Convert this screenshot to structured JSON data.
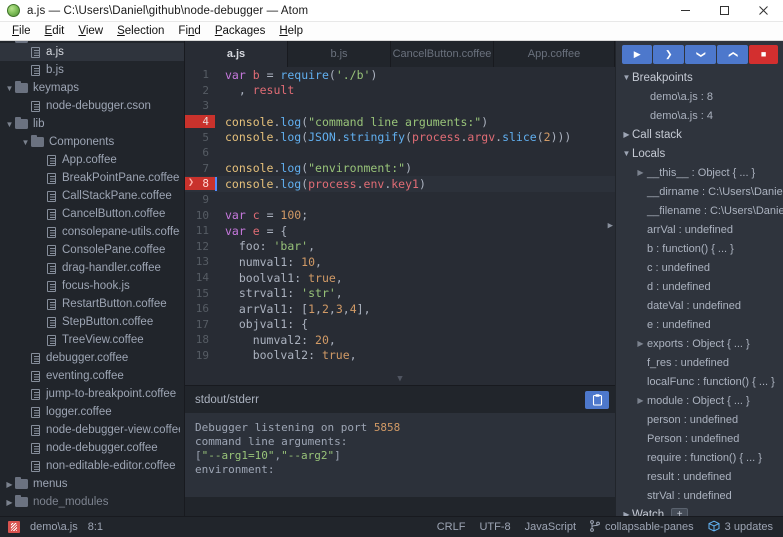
{
  "window": {
    "title": "a.js — C:\\Users\\Daniel\\github\\node-debugger — Atom",
    "app_icon": "atom-logo-icon",
    "minimize_label": "minimize-icon",
    "maximize_label": "maximize-icon",
    "close_label": "close-icon"
  },
  "menubar": {
    "items": [
      {
        "label": "File",
        "accel": "F"
      },
      {
        "label": "Edit",
        "accel": "E"
      },
      {
        "label": "View",
        "accel": "V"
      },
      {
        "label": "Selection",
        "accel": "S"
      },
      {
        "label": "Find",
        "accel": "n"
      },
      {
        "label": "Packages",
        "accel": "P"
      },
      {
        "label": "Help",
        "accel": "H"
      }
    ]
  },
  "tree": {
    "items": [
      {
        "label": "demo",
        "type": "folder",
        "depth": 1,
        "expanded": true,
        "selected": false,
        "clipped": true
      },
      {
        "label": "a.js",
        "type": "file",
        "depth": 2,
        "selected": true
      },
      {
        "label": "b.js",
        "type": "file",
        "depth": 2,
        "selected": false
      },
      {
        "label": "keymaps",
        "type": "folder",
        "depth": 1,
        "expanded": true,
        "selected": false
      },
      {
        "label": "node-debugger.cson",
        "type": "file",
        "depth": 2,
        "selected": false
      },
      {
        "label": "lib",
        "type": "folder",
        "depth": 1,
        "expanded": true,
        "selected": false
      },
      {
        "label": "Components",
        "type": "folder",
        "depth": 2,
        "expanded": true,
        "selected": false
      },
      {
        "label": "App.coffee",
        "type": "file",
        "depth": 3,
        "selected": false
      },
      {
        "label": "BreakPointPane.coffee",
        "type": "file",
        "depth": 3,
        "selected": false
      },
      {
        "label": "CallStackPane.coffee",
        "type": "file",
        "depth": 3,
        "selected": false
      },
      {
        "label": "CancelButton.coffee",
        "type": "file",
        "depth": 3,
        "selected": false
      },
      {
        "label": "consolepane-utils.coffee",
        "type": "file",
        "depth": 3,
        "selected": false
      },
      {
        "label": "ConsolePane.coffee",
        "type": "file",
        "depth": 3,
        "selected": false
      },
      {
        "label": "drag-handler.coffee",
        "type": "file",
        "depth": 3,
        "selected": false
      },
      {
        "label": "focus-hook.js",
        "type": "file",
        "depth": 3,
        "selected": false
      },
      {
        "label": "RestartButton.coffee",
        "type": "file",
        "depth": 3,
        "selected": false
      },
      {
        "label": "StepButton.coffee",
        "type": "file",
        "depth": 3,
        "selected": false
      },
      {
        "label": "TreeView.coffee",
        "type": "file",
        "depth": 3,
        "selected": false
      },
      {
        "label": "debugger.coffee",
        "type": "file",
        "depth": 2,
        "selected": false
      },
      {
        "label": "eventing.coffee",
        "type": "file",
        "depth": 2,
        "selected": false
      },
      {
        "label": "jump-to-breakpoint.coffee",
        "type": "file",
        "depth": 2,
        "selected": false
      },
      {
        "label": "logger.coffee",
        "type": "file",
        "depth": 2,
        "selected": false
      },
      {
        "label": "node-debugger-view.coffee",
        "type": "file",
        "depth": 2,
        "selected": false
      },
      {
        "label": "node-debugger.coffee",
        "type": "file",
        "depth": 2,
        "selected": false
      },
      {
        "label": "non-editable-editor.coffee",
        "type": "file",
        "depth": 2,
        "selected": false
      },
      {
        "label": "menus",
        "type": "folder",
        "depth": 1,
        "expanded": false,
        "selected": false
      },
      {
        "label": "node_modules",
        "type": "folder",
        "depth": 1,
        "expanded": false,
        "selected": false,
        "dim": true
      }
    ]
  },
  "tabs": [
    {
      "label": "a.js",
      "active": true
    },
    {
      "label": "b.js",
      "active": false
    },
    {
      "label": "CancelButton.coffee",
      "active": false
    },
    {
      "label": "App.coffee",
      "active": false
    }
  ],
  "editor": {
    "lines": [
      {
        "n": "1",
        "breakpoint": false,
        "current": false,
        "tokens": [
          {
            "t": "var ",
            "c": "kw"
          },
          {
            "t": "b",
            "c": "var"
          },
          {
            "t": " = ",
            "c": "pun"
          },
          {
            "t": "require",
            "c": "fn"
          },
          {
            "t": "(",
            "c": "pun"
          },
          {
            "t": "'./b'",
            "c": "str"
          },
          {
            "t": ")",
            "c": "pun"
          }
        ]
      },
      {
        "n": "2",
        "breakpoint": false,
        "current": false,
        "tokens": [
          {
            "t": "  , ",
            "c": "pun"
          },
          {
            "t": "result",
            "c": "var"
          }
        ]
      },
      {
        "n": "3",
        "breakpoint": false,
        "current": false,
        "tokens": []
      },
      {
        "n": "4",
        "breakpoint": true,
        "current": false,
        "tokens": [
          {
            "t": "console",
            "c": "obj"
          },
          {
            "t": ".",
            "c": "pun"
          },
          {
            "t": "log",
            "c": "fn"
          },
          {
            "t": "(",
            "c": "pun"
          },
          {
            "t": "\"command line arguments:\"",
            "c": "str"
          },
          {
            "t": ")",
            "c": "pun"
          }
        ]
      },
      {
        "n": "5",
        "breakpoint": false,
        "current": false,
        "tokens": [
          {
            "t": "console",
            "c": "obj"
          },
          {
            "t": ".",
            "c": "pun"
          },
          {
            "t": "log",
            "c": "fn"
          },
          {
            "t": "(",
            "c": "pun"
          },
          {
            "t": "JSON",
            "c": "fn"
          },
          {
            "t": ".",
            "c": "pun"
          },
          {
            "t": "stringify",
            "c": "fn"
          },
          {
            "t": "(",
            "c": "pun"
          },
          {
            "t": "process",
            "c": "var"
          },
          {
            "t": ".",
            "c": "pun"
          },
          {
            "t": "argv",
            "c": "var"
          },
          {
            "t": ".",
            "c": "pun"
          },
          {
            "t": "slice",
            "c": "fn"
          },
          {
            "t": "(",
            "c": "pun"
          },
          {
            "t": "2",
            "c": "num"
          },
          {
            "t": ")))",
            "c": "pun"
          }
        ]
      },
      {
        "n": "6",
        "breakpoint": false,
        "current": false,
        "tokens": []
      },
      {
        "n": "7",
        "breakpoint": false,
        "current": false,
        "tokens": [
          {
            "t": "console",
            "c": "obj"
          },
          {
            "t": ".",
            "c": "pun"
          },
          {
            "t": "log",
            "c": "fn"
          },
          {
            "t": "(",
            "c": "pun"
          },
          {
            "t": "\"environment:\"",
            "c": "str"
          },
          {
            "t": ")",
            "c": "pun"
          }
        ]
      },
      {
        "n": "8",
        "breakpoint": true,
        "current": true,
        "tokens": [
          {
            "t": "console",
            "c": "obj"
          },
          {
            "t": ".",
            "c": "pun"
          },
          {
            "t": "log",
            "c": "fn"
          },
          {
            "t": "(",
            "c": "pun"
          },
          {
            "t": "process",
            "c": "var"
          },
          {
            "t": ".",
            "c": "pun"
          },
          {
            "t": "env",
            "c": "var"
          },
          {
            "t": ".",
            "c": "pun"
          },
          {
            "t": "key1",
            "c": "var"
          },
          {
            "t": ")",
            "c": "pun"
          }
        ]
      },
      {
        "n": "9",
        "breakpoint": false,
        "current": false,
        "tokens": []
      },
      {
        "n": "10",
        "breakpoint": false,
        "current": false,
        "tokens": [
          {
            "t": "var ",
            "c": "kw"
          },
          {
            "t": "c",
            "c": "var"
          },
          {
            "t": " = ",
            "c": "pun"
          },
          {
            "t": "100",
            "c": "num"
          },
          {
            "t": ";",
            "c": "pun"
          }
        ]
      },
      {
        "n": "11",
        "breakpoint": false,
        "current": false,
        "tokens": [
          {
            "t": "var ",
            "c": "kw"
          },
          {
            "t": "e",
            "c": "var"
          },
          {
            "t": " = {",
            "c": "pun"
          }
        ]
      },
      {
        "n": "12",
        "breakpoint": false,
        "current": false,
        "tokens": [
          {
            "t": "  foo: ",
            "c": "prop"
          },
          {
            "t": "'bar'",
            "c": "str"
          },
          {
            "t": ",",
            "c": "pun"
          }
        ]
      },
      {
        "n": "13",
        "breakpoint": false,
        "current": false,
        "tokens": [
          {
            "t": "  numval1: ",
            "c": "prop"
          },
          {
            "t": "10",
            "c": "num"
          },
          {
            "t": ",",
            "c": "pun"
          }
        ]
      },
      {
        "n": "14",
        "breakpoint": false,
        "current": false,
        "tokens": [
          {
            "t": "  boolval1: ",
            "c": "prop"
          },
          {
            "t": "true",
            "c": "bool"
          },
          {
            "t": ",",
            "c": "pun"
          }
        ]
      },
      {
        "n": "15",
        "breakpoint": false,
        "current": false,
        "tokens": [
          {
            "t": "  strval1: ",
            "c": "prop"
          },
          {
            "t": "'str'",
            "c": "str"
          },
          {
            "t": ",",
            "c": "pun"
          }
        ]
      },
      {
        "n": "16",
        "breakpoint": false,
        "current": false,
        "tokens": [
          {
            "t": "  arrVal1: [",
            "c": "prop"
          },
          {
            "t": "1",
            "c": "num"
          },
          {
            "t": ",",
            "c": "pun"
          },
          {
            "t": "2",
            "c": "num"
          },
          {
            "t": ",",
            "c": "pun"
          },
          {
            "t": "3",
            "c": "num"
          },
          {
            "t": ",",
            "c": "pun"
          },
          {
            "t": "4",
            "c": "num"
          },
          {
            "t": "],",
            "c": "pun"
          }
        ]
      },
      {
        "n": "17",
        "breakpoint": false,
        "current": false,
        "tokens": [
          {
            "t": "  objval1: {",
            "c": "prop"
          }
        ]
      },
      {
        "n": "18",
        "breakpoint": false,
        "current": false,
        "tokens": [
          {
            "t": "    numval2: ",
            "c": "prop"
          },
          {
            "t": "20",
            "c": "num"
          },
          {
            "t": ",",
            "c": "pun"
          }
        ]
      },
      {
        "n": "19",
        "breakpoint": false,
        "current": false,
        "tokens": [
          {
            "t": "    boolval2: ",
            "c": "prop"
          },
          {
            "t": "true",
            "c": "bool"
          },
          {
            "t": ",",
            "c": "pun"
          }
        ]
      }
    ],
    "scroll_down_icon": "chevron-down-icon",
    "pane_handle_icon": "expand-pane-icon"
  },
  "console": {
    "title": "stdout/stderr",
    "clear_icon": "clipboard-clear-icon",
    "lines": [
      {
        "parts": [
          {
            "t": "Debugger listening on port ",
            "c": ""
          },
          {
            "t": "5858",
            "c": "on"
          }
        ]
      },
      {
        "parts": [
          {
            "t": "command line arguments:",
            "c": ""
          }
        ]
      },
      {
        "parts": [
          {
            "t": "[",
            "c": ""
          },
          {
            "t": "\"--arg1=10\"",
            "c": "gn"
          },
          {
            "t": ",",
            "c": ""
          },
          {
            "t": "\"--arg2\"",
            "c": "gn"
          },
          {
            "t": "]",
            "c": ""
          }
        ]
      },
      {
        "parts": [
          {
            "t": "environment:",
            "c": ""
          }
        ]
      }
    ]
  },
  "debugger": {
    "toolbar": [
      {
        "name": "resume-button",
        "icon": "play-icon",
        "glyph": "▶",
        "style": "primary"
      },
      {
        "name": "step-over-button",
        "icon": "chevron-right-icon",
        "glyph": "❯",
        "style": "primary"
      },
      {
        "name": "step-into-button",
        "icon": "chevron-down-icon",
        "glyph": "❯",
        "style": "primary"
      },
      {
        "name": "step-out-button",
        "icon": "chevron-up-icon",
        "glyph": "❯",
        "style": "primary"
      },
      {
        "name": "stop-button",
        "icon": "stop-square-icon",
        "glyph": "■",
        "style": "danger"
      }
    ],
    "sections": [
      {
        "title": "Breakpoints",
        "expanded": true
      },
      {
        "title": "Call stack",
        "expanded": false
      },
      {
        "title": "Locals",
        "expanded": true
      },
      {
        "title": "Watch",
        "expanded": false
      }
    ],
    "breakpoints": [
      "demo\\a.js : 8",
      "demo\\a.js : 4"
    ],
    "locals": [
      {
        "label": "__this__ : Object { ... }",
        "expandable": true
      },
      {
        "label": "__dirname : C:\\Users\\Daniel\\github\\",
        "expandable": false
      },
      {
        "label": "__filename : C:\\Users\\Daniel\\github\\",
        "expandable": false
      },
      {
        "label": "arrVal : undefined",
        "expandable": false
      },
      {
        "label": "b : function() { ... }",
        "expandable": false
      },
      {
        "label": "c : undefined",
        "expandable": false
      },
      {
        "label": "d : undefined",
        "expandable": false
      },
      {
        "label": "dateVal : undefined",
        "expandable": false
      },
      {
        "label": "e : undefined",
        "expandable": false
      },
      {
        "label": "exports : Object { ... }",
        "expandable": true
      },
      {
        "label": "f_res : undefined",
        "expandable": false
      },
      {
        "label": "localFunc : function() { ... }",
        "expandable": false
      },
      {
        "label": "module : Object { ... }",
        "expandable": true
      },
      {
        "label": "person : undefined",
        "expandable": false
      },
      {
        "label": "Person : undefined",
        "expandable": false
      },
      {
        "label": "require : function() { ... }",
        "expandable": false
      },
      {
        "label": "result : undefined",
        "expandable": false
      },
      {
        "label": "strVal : undefined",
        "expandable": false
      }
    ],
    "watch_add_label": "+"
  },
  "statusbar": {
    "mark_icon": "modified-file-icon",
    "file": "demo\\a.js",
    "cursor": "8:1",
    "line_ending": "CRLF",
    "encoding": "UTF-8",
    "grammar": "JavaScript",
    "branch_icon": "git-branch-icon",
    "branch": "collapsable-panes",
    "updates_icon": "package-box-icon",
    "updates": "3 updates"
  }
}
